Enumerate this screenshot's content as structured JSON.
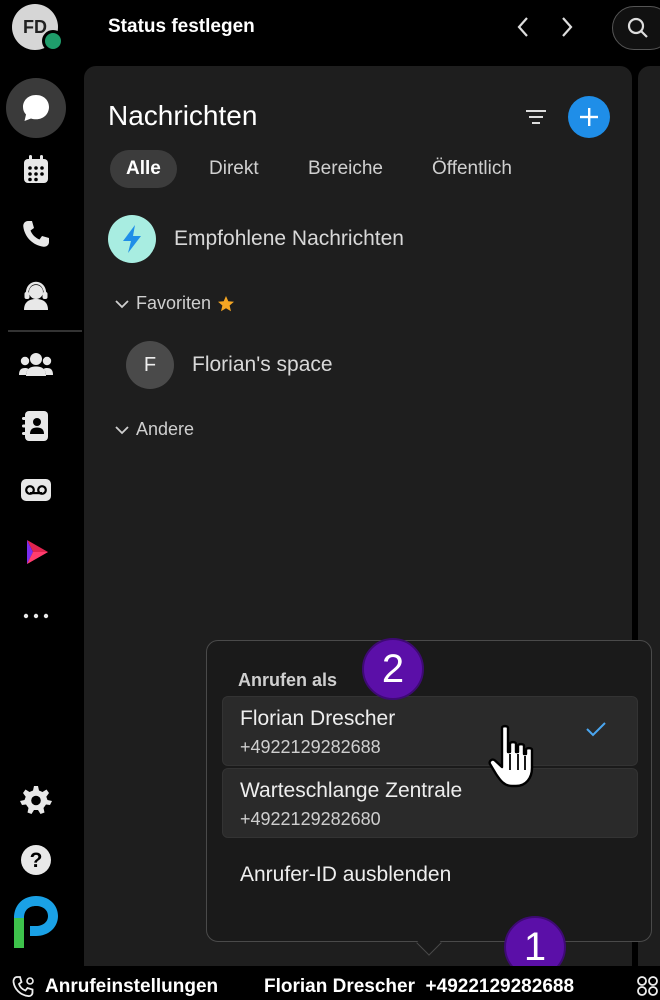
{
  "topbar": {
    "avatar_initials": "FD",
    "status_label": "Status festlegen"
  },
  "rail": {
    "items": [
      {
        "name": "chat-icon",
        "active": true
      },
      {
        "name": "calendar-icon"
      },
      {
        "name": "phone-icon"
      },
      {
        "name": "headset-icon"
      },
      {
        "name": "team-icon"
      },
      {
        "name": "contacts-icon"
      },
      {
        "name": "voicemail-icon"
      },
      {
        "name": "webex-app-icon"
      },
      {
        "name": "more-icon"
      }
    ],
    "bottom": [
      "settings-icon",
      "help-icon",
      "brand-logo"
    ]
  },
  "messages": {
    "title": "Nachrichten",
    "tabs": [
      "Alle",
      "Direkt",
      "Bereiche",
      "Öffentlich"
    ],
    "active_tab": "Alle",
    "recommended": "Empfohlene Nachrichten",
    "favorites_label": "Favoriten",
    "space": {
      "initial": "F",
      "name": "Florian's space"
    },
    "other_label": "Andere"
  },
  "popup": {
    "heading": "Anrufen als",
    "options": [
      {
        "name": "Florian Drescher",
        "number": "+4922129282688",
        "selected": true
      },
      {
        "name": "Warteschlange Zentrale",
        "number": "+4922129282680",
        "selected": false
      }
    ],
    "hide_id": "Anrufer-ID ausblenden"
  },
  "badges": {
    "one": "1",
    "two": "2"
  },
  "bottombar": {
    "settings_label": "Anrufeinstellungen",
    "caller_label": "Florian Drescher  +4922129282688"
  },
  "colors": {
    "accent": "#1f8ee8",
    "presence": "#1f9d6b",
    "badge": "#5b0fa8",
    "favorite_star": "#f5a623"
  }
}
